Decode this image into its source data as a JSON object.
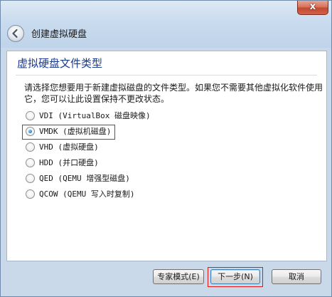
{
  "window": {
    "title": "创建虚拟硬盘",
    "close_glyph": "x"
  },
  "page": {
    "heading": "虚拟硬盘文件类型",
    "description": "请选择您想要用于新建虚拟磁盘的文件类型。如果您不需要其他虚拟化软件使用它，您可以让此设置保持不更改状态。"
  },
  "options": [
    {
      "label": "VDI (VirtualBox 磁盘映像)",
      "checked": false
    },
    {
      "label": "VMDK (虚拟机磁盘)",
      "checked": true
    },
    {
      "label": "VHD (虚拟硬盘)",
      "checked": false
    },
    {
      "label": "HDD (并口硬盘)",
      "checked": false
    },
    {
      "label": "QED (QEMU 增强型磁盘)",
      "checked": false
    },
    {
      "label": "QCOW (QEMU 写入时复制)",
      "checked": false
    }
  ],
  "buttons": {
    "expert": "专家模式(E)",
    "next": "下一步(N)",
    "cancel": "取消"
  },
  "icons": {
    "back": "back-arrow-icon",
    "close": "close-icon"
  }
}
